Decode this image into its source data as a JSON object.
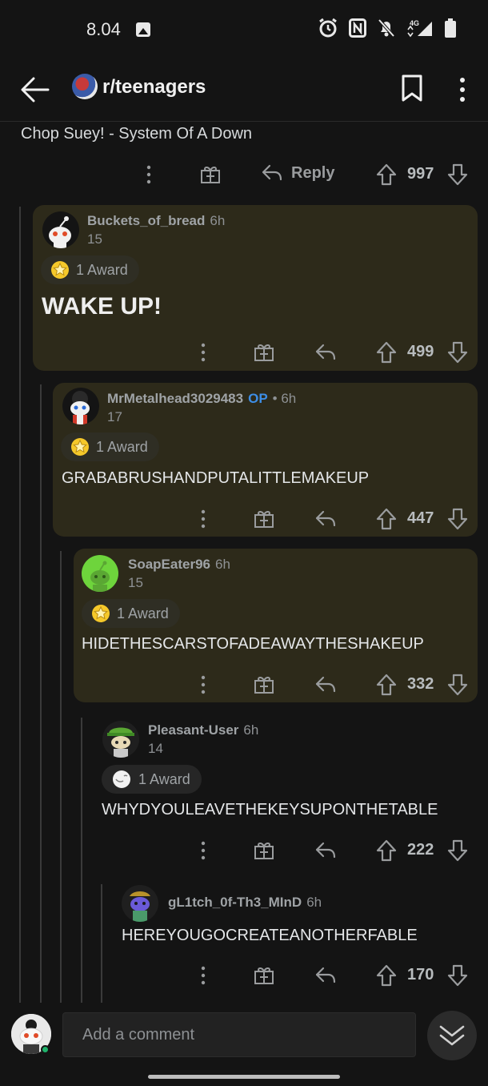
{
  "status_bar": {
    "time": "8.04",
    "network": "4G",
    "icons": [
      "image-icon",
      "alarm-icon",
      "nfc-icon",
      "bell-off-icon",
      "signal-icon",
      "battery-icon"
    ]
  },
  "header": {
    "subreddit": "r/teenagers",
    "icons": [
      "back-arrow-icon",
      "bookmark-icon",
      "more-vertical-icon"
    ]
  },
  "post": {
    "title": "Chop Suey! - System Of A Down",
    "reply_label": "Reply",
    "votes": "997"
  },
  "comments": [
    {
      "user": "Buckets_of_bread",
      "op": "",
      "time": "6h",
      "karma": "15",
      "award": "1 Award",
      "body": "WAKE UP!",
      "votes": "499"
    },
    {
      "user": "MrMetalhead3029483",
      "op": "OP",
      "time": "• 6h",
      "karma": "17",
      "award": "1 Award",
      "body": "GRABABRUSHANDPUTALITTLEMAKEUP",
      "votes": "447"
    },
    {
      "user": "SoapEater96",
      "op": "",
      "time": "6h",
      "karma": "15",
      "award": "1 Award",
      "body": "HIDETHESCARSTOFADEAWAYTHESHAKEUP",
      "votes": "332"
    },
    {
      "user": "Pleasant-User",
      "op": "",
      "time": "6h",
      "karma": "14",
      "award": "1 Award",
      "body": "WHYDYOULEAVETHEKEYSUPONTHETABLE",
      "votes": "222"
    },
    {
      "user": "gL1tch_0f-Th3_MInD",
      "op": "",
      "time": "6h",
      "karma": "",
      "award": "",
      "body": "HEREYOUGOCREATEANOTHERFABLE",
      "votes": "170"
    }
  ],
  "composer": {
    "placeholder": "Add a comment"
  },
  "colors": {
    "background": "#141414",
    "highlight": "#2d2a1a",
    "op_blue": "#3d8ee6",
    "online_green": "#1fb36b"
  }
}
